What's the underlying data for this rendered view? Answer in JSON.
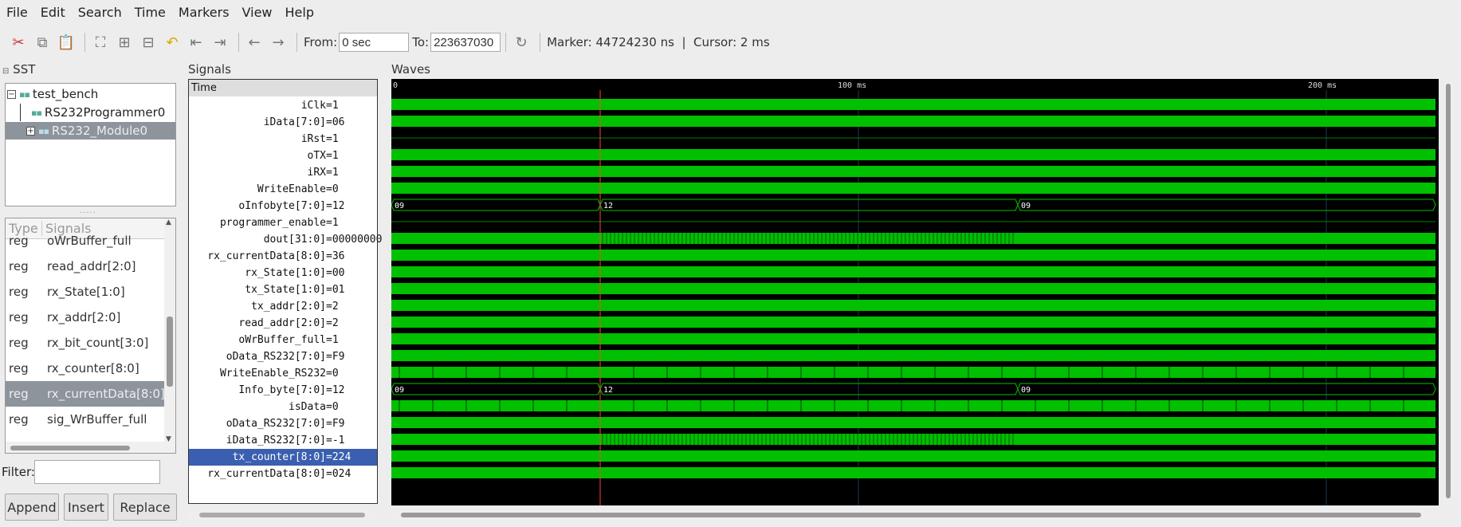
{
  "menu": [
    "File",
    "Edit",
    "Search",
    "Time",
    "Markers",
    "View",
    "Help"
  ],
  "toolbar": {
    "icons": [
      "cut-icon",
      "copy-icon",
      "paste-icon",
      "zoom-fit-icon",
      "zoom-in-icon",
      "zoom-out-icon",
      "undo-zoom-icon",
      "zoom-to-start-icon",
      "zoom-to-end-icon",
      "prev-edge-icon",
      "next-edge-icon"
    ],
    "from_label": "From:",
    "from_value": "0 sec",
    "to_label": "To:",
    "to_value": "223637030",
    "reload_icon": "reload-icon",
    "marker_cursor": "Marker: 44724230 ns  |  Cursor: 2 ms"
  },
  "panels": {
    "sst": "SST",
    "signals": "Signals",
    "waves": "Waves"
  },
  "tree": [
    {
      "label": "test_bench",
      "expander": "-",
      "level": 0,
      "selected": false
    },
    {
      "label": "RS232Programmer0",
      "expander": "",
      "level": 1,
      "selected": false
    },
    {
      "label": "RS232_Module0",
      "expander": "+",
      "level": 1,
      "selected": true
    }
  ],
  "siglist": {
    "col_type": "Type",
    "col_signals": "Signals",
    "rows": [
      {
        "type": "reg",
        "name": "oWrBuffer_full",
        "selected": false
      },
      {
        "type": "reg",
        "name": "read_addr[2:0]",
        "selected": false
      },
      {
        "type": "reg",
        "name": "rx_State[1:0]",
        "selected": false
      },
      {
        "type": "reg",
        "name": "rx_addr[2:0]",
        "selected": false
      },
      {
        "type": "reg",
        "name": "rx_bit_count[3:0]",
        "selected": false
      },
      {
        "type": "reg",
        "name": "rx_counter[8:0]",
        "selected": false
      },
      {
        "type": "reg",
        "name": "rx_currentData[8:0]",
        "selected": true
      },
      {
        "type": "reg",
        "name": "sig_WrBuffer_full",
        "selected": false
      }
    ]
  },
  "filter": {
    "label": "Filter:",
    "value": ""
  },
  "buttons": {
    "append": "Append",
    "insert": "Insert",
    "replace": "Replace"
  },
  "signals_header": "Time",
  "signals": [
    {
      "name": "iClk",
      "value": "1"
    },
    {
      "name": "iData[7:0]",
      "value": "06"
    },
    {
      "name": "iRst",
      "value": "1"
    },
    {
      "name": "oTX",
      "value": "1"
    },
    {
      "name": "iRX",
      "value": "1"
    },
    {
      "name": "WriteEnable",
      "value": "0"
    },
    {
      "name": "oInfobyte[7:0]",
      "value": "12"
    },
    {
      "name": "programmer_enable",
      "value": "1"
    },
    {
      "name": "dout[31:0]",
      "value": "00000000"
    },
    {
      "name": "rx_currentData[8:0]",
      "value": "36"
    },
    {
      "name": "rx_State[1:0]",
      "value": "00"
    },
    {
      "name": "tx_State[1:0]",
      "value": "01"
    },
    {
      "name": "tx_addr[2:0]",
      "value": "2"
    },
    {
      "name": "read_addr[2:0]",
      "value": "2"
    },
    {
      "name": "oWrBuffer_full",
      "value": "1"
    },
    {
      "name": "oData_RS232[7:0]",
      "value": "F9"
    },
    {
      "name": "WriteEnable_RS232",
      "value": "0"
    },
    {
      "name": "Info_byte[7:0]",
      "value": "12"
    },
    {
      "name": "isData",
      "value": "0"
    },
    {
      "name": "oData_RS232[7:0]",
      "value": "F9"
    },
    {
      "name": "iData_RS232[7:0]",
      "value": "-1"
    },
    {
      "name": "tx_counter[8:0]",
      "value": "224",
      "selected": true
    },
    {
      "name": "rx_currentData[8:0]",
      "value": "024"
    }
  ],
  "waves": {
    "ruler_labels": [
      "0",
      "100 ms",
      "200 ms"
    ],
    "bus_labels": {
      "oInfobyte": [
        "09",
        "12",
        "09"
      ],
      "Info_byte": [
        "09",
        "12",
        "09"
      ]
    },
    "colors": {
      "wave": "#00c000",
      "wave_dark": "#008000",
      "cursor": "#ff4040",
      "grid": "#1a3a5a"
    }
  }
}
